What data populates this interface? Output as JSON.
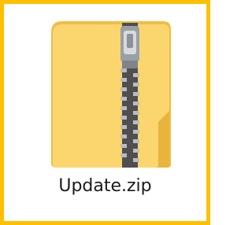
{
  "file": {
    "name": "Update.zip",
    "type_icon": "zip-archive-folder-icon"
  },
  "colors": {
    "highlight_border": "#ffc000",
    "folder_back": "#f2c24a",
    "folder_front": "#fbd66f",
    "zipper_tape": "#5a5a5a",
    "zipper_pull": "#9aa0a6"
  }
}
